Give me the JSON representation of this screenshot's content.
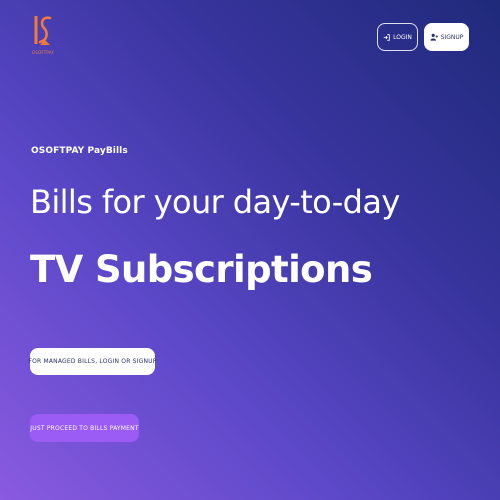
{
  "brand": {
    "logo_icon": "osoftpay-logo-icon",
    "logo_caption": "OSOFTPAY",
    "accent_color": "#f07a3c"
  },
  "header": {
    "login_label": "LOGIN",
    "login_icon": "login-arrow-icon",
    "signup_label": "SIGNUP",
    "signup_icon": "user-plus-icon"
  },
  "hero": {
    "eyebrow": "OSOFTPAY PayBills",
    "headline_light": "Bills for your day-to-day",
    "headline_bold": "TV Subscriptions",
    "managed_button_label": "FOR MANAGED BILLS, LOGIN OR SIGNUP",
    "proceed_button_label": "JUST PROCEED TO BILLS PAYMENT",
    "proceed_button_color": "#9a5cf5"
  },
  "colors": {
    "background_start": "#1f2a7a",
    "background_end": "#8a5ae0"
  }
}
